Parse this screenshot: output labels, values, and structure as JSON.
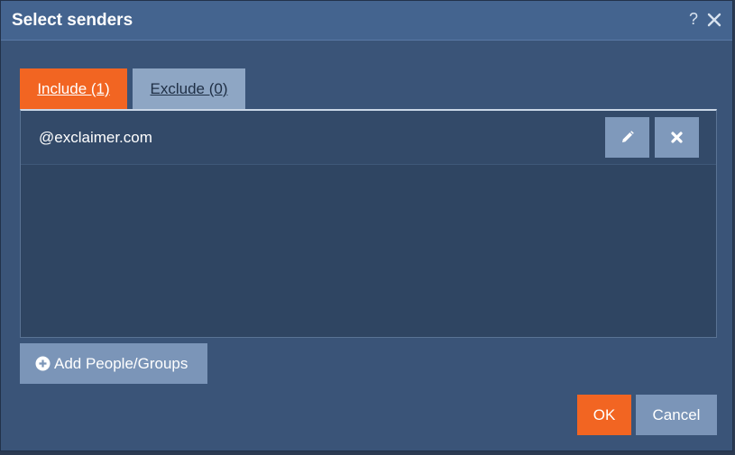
{
  "dialog": {
    "title": "Select senders",
    "help_label": "?"
  },
  "tabs": [
    {
      "label": "Include (1)",
      "active": true
    },
    {
      "label": "Exclude (0)",
      "active": false
    }
  ],
  "senders": [
    {
      "value": "@exclaimer.com"
    }
  ],
  "actions": {
    "add_label": "Add People/Groups",
    "ok_label": "OK",
    "cancel_label": "Cancel"
  },
  "colors": {
    "accent": "#f26522",
    "dialog_bg": "#3a5478",
    "titlebar_bg": "#44648f",
    "panel_bg": "#2f4562",
    "secondary_button": "#7b95b8"
  },
  "icons": {
    "help": "help-icon",
    "close": "close-icon",
    "edit": "pencil-icon",
    "delete": "x-icon",
    "add": "plus-circle-icon"
  }
}
